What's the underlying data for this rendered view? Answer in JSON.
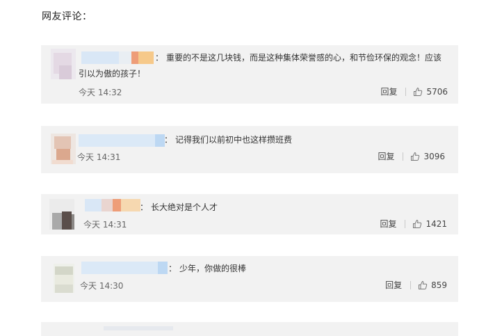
{
  "section_title": "网友评论：",
  "colors": {
    "card_bg": "#f2f2f2",
    "text": "#333333",
    "muted": "#666666"
  },
  "comments": [
    {
      "text_line1": "重要的不是这几块钱，而是这种集体荣誉感的心，和节俭环保的观念！应该",
      "text_line2": "引以为傲的孩子！",
      "time": "今天 14:32",
      "reply": "回复",
      "likes": "5706"
    },
    {
      "text_line1": "记得我们以前初中也这样攒班费",
      "time": "今天 14:31",
      "reply": "回复",
      "likes": "3096"
    },
    {
      "text_line1": "长大绝对是个人才",
      "time": "今天 14:31",
      "reply": "回复",
      "likes": "1421"
    },
    {
      "text_line1": "少年，你做的很棒",
      "time": "今天 14:30",
      "reply": "回复",
      "likes": "859"
    }
  ],
  "icons": {
    "like": "thumbs-up-icon"
  }
}
